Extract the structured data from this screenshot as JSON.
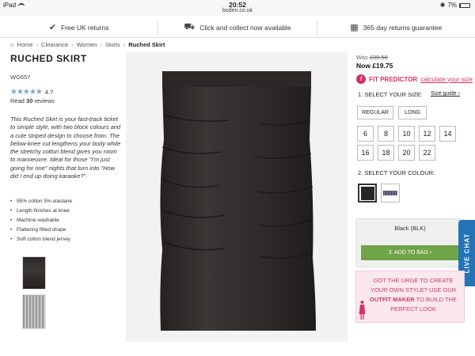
{
  "status_bar": {
    "device": "iPad",
    "time": "20:52",
    "url": "boden.co.uk",
    "battery": "7%"
  },
  "service_bar": [
    {
      "icon": "tick-circle-icon",
      "label": "Free UK returns"
    },
    {
      "icon": "delivery-van-icon",
      "label": "Click and collect now available"
    },
    {
      "icon": "calendar-icon",
      "label": "365 day returns guarantee"
    }
  ],
  "breadcrumb": {
    "home": "Home",
    "items": [
      "Clearance",
      "Women",
      "Skirts"
    ],
    "current": "Ruched Skirt"
  },
  "product": {
    "title": "RUCHED SKIRT",
    "code": "WG657",
    "rating": "4.7",
    "rating_stars": 4.7,
    "reviews_prefix": "Read",
    "reviews_count": "30",
    "reviews_suffix": "reviews",
    "description": "This Ruched Skirt is your fast-track ticket to simple style, with two block colours and a cute striped design to choose from. The below-knee cut lengthens your body while the stretchy cotton blend gives you room to manoeuvre. Ideal for those \"I'm just going for one\" nights that turn into \"How did I end up doing karaoke?\".",
    "features": [
      "95% cotton 5% elastane",
      "Length finishes at knee",
      "Machine washable",
      "Flattering fitted shape",
      "Soft cotton blend jersey"
    ]
  },
  "price": {
    "was_label": "Was",
    "was_value": "£39.50",
    "now_label": "Now",
    "now_value": "£19.75"
  },
  "fit_predictor": {
    "label": "FIT PREDICTOR",
    "link": "calculate your size"
  },
  "size": {
    "heading": "1. SELECT YOUR SIZE:",
    "guide": "Size guide",
    "lengths": [
      "REGULAR",
      "LONG"
    ],
    "sizes": [
      "6",
      "8",
      "10",
      "12",
      "14",
      "16",
      "18",
      "20",
      "22"
    ]
  },
  "colour": {
    "heading": "2. SELECT YOUR COLOUR:",
    "selected": "Black (BLK)"
  },
  "add_to_bag": "3. ADD TO BAG ›",
  "live_chat": "LIVE CHAT",
  "outfit_maker": {
    "line1": "GOT THE URGE TO CREATE",
    "line2": "YOUR OWN STYLE? USE OUR",
    "highlight": "OUTFIT MAKER",
    "line3": "TO BUILD THE",
    "line4": "PERFECT LOOK"
  },
  "colors": {
    "accent_pink": "#d82f6a",
    "add_button_green": "#6fa448",
    "live_chat_blue": "#2573b7",
    "star_blue": "#7aa7c7"
  }
}
